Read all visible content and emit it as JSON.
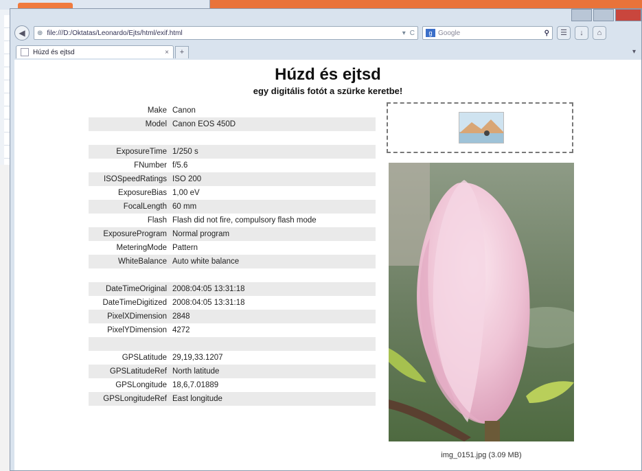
{
  "browser": {
    "url": "file:///D:/Oktatas/Leonardo/Ejts/html/exif.html",
    "search_placeholder": "Google",
    "tab_title": "Húzd és ejtsd"
  },
  "page": {
    "title": "Húzd és ejtsd",
    "subtitle": "egy digitális fotót a szürke keretbe!",
    "exif": [
      {
        "k": "Make",
        "v": "Canon"
      },
      {
        "k": "Model",
        "v": "Canon EOS 450D"
      },
      {
        "k": "",
        "v": ""
      },
      {
        "k": "ExposureTime",
        "v": "1/250 s"
      },
      {
        "k": "FNumber",
        "v": "f/5.6"
      },
      {
        "k": "ISOSpeedRatings",
        "v": "ISO 200"
      },
      {
        "k": "ExposureBias",
        "v": "1,00 eV"
      },
      {
        "k": "FocalLength",
        "v": "60 mm"
      },
      {
        "k": "Flash",
        "v": "Flash did not fire, compulsory flash mode"
      },
      {
        "k": "ExposureProgram",
        "v": "Normal program"
      },
      {
        "k": "MeteringMode",
        "v": "Pattern"
      },
      {
        "k": "WhiteBalance",
        "v": "Auto white balance"
      },
      {
        "k": "",
        "v": ""
      },
      {
        "k": "DateTimeOriginal",
        "v": "2008:04:05 13:31:18"
      },
      {
        "k": "DateTimeDigitized",
        "v": "2008:04:05 13:31:18"
      },
      {
        "k": "PixelXDimension",
        "v": "2848"
      },
      {
        "k": "PixelYDimension",
        "v": "4272"
      },
      {
        "k": "",
        "v": ""
      },
      {
        "k": "GPSLatitude",
        "v": "29,19,33.1207"
      },
      {
        "k": "GPSLatitudeRef",
        "v": "North latitude"
      },
      {
        "k": "GPSLongitude",
        "v": "18,6,7.01889"
      },
      {
        "k": "GPSLongitudeRef",
        "v": "East longitude"
      }
    ],
    "caption": "img_0151.jpg (3.09 MB)"
  },
  "colors": {
    "desktop": "#e9733a",
    "chrome": "#d9e3ee"
  },
  "icons": [
    "back-icon",
    "globe-icon",
    "refresh-icon",
    "search-icon",
    "home-icon",
    "download-icon"
  ]
}
